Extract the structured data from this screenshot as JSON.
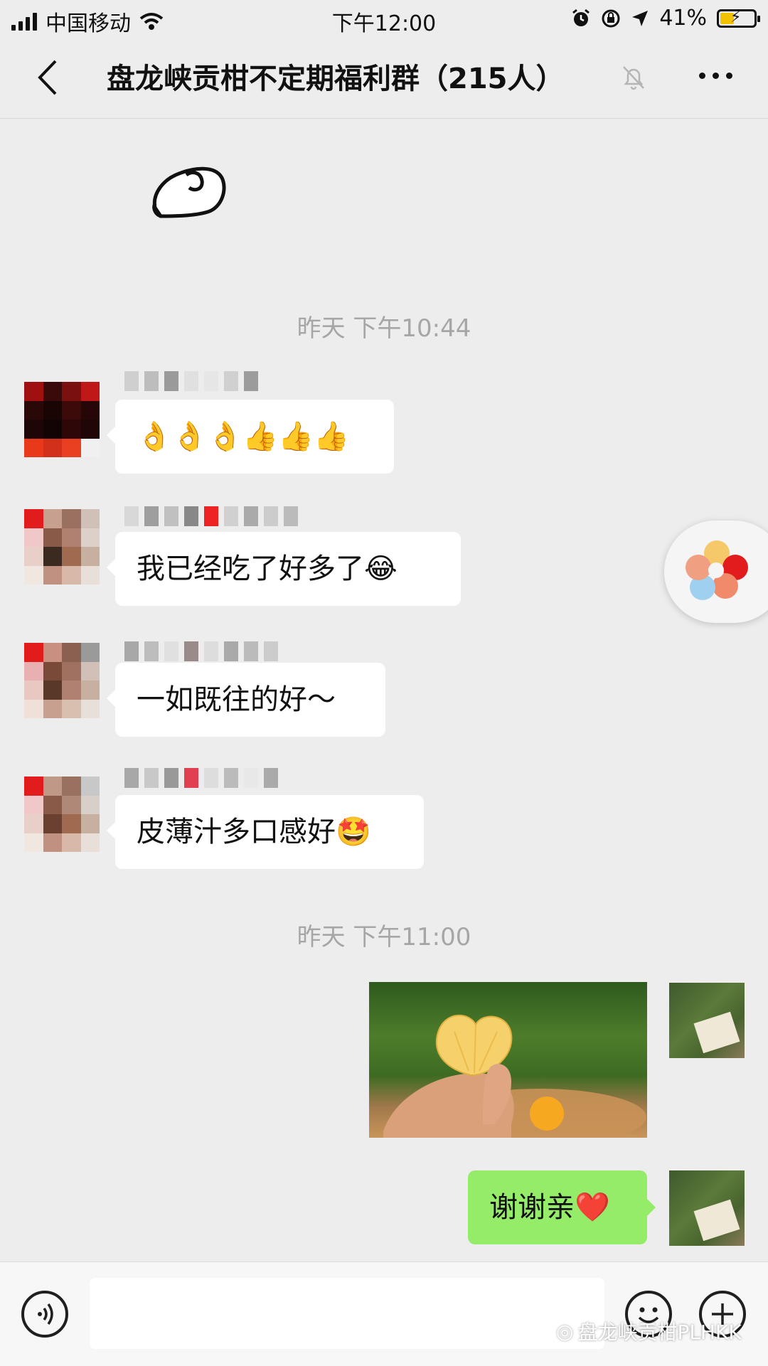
{
  "status_bar": {
    "carrier": "中国移动",
    "time": "下午12:00",
    "battery": "41%",
    "battery_level": 0.41,
    "icons": [
      "signal-icon",
      "wifi-icon",
      "alarm-icon",
      "rotation-lock-icon",
      "location-icon",
      "battery-icon"
    ]
  },
  "header": {
    "title": "盘龙峡贡柑不定期福利群（215人）",
    "icons": [
      "back-icon",
      "mute-bell-icon",
      "more-icon"
    ]
  },
  "messages": {
    "time1": "昨天 下午10:44",
    "msg1": "👌👌👌👍👍👍",
    "msg2": "我已经吃了好多了😂",
    "msg3": "一如既往的好～",
    "msg4": "皮薄汁多口感好🤩",
    "time2": "昨天 下午11:00",
    "msg_mine": "谢谢亲❤️"
  },
  "watermark": "盘龙峡贡柑PLHKK",
  "colors": {
    "background": "#ededed",
    "my_bubble": "#95ec69",
    "other_bubble": "#ffffff",
    "timestamp": "#a6a6a6"
  }
}
